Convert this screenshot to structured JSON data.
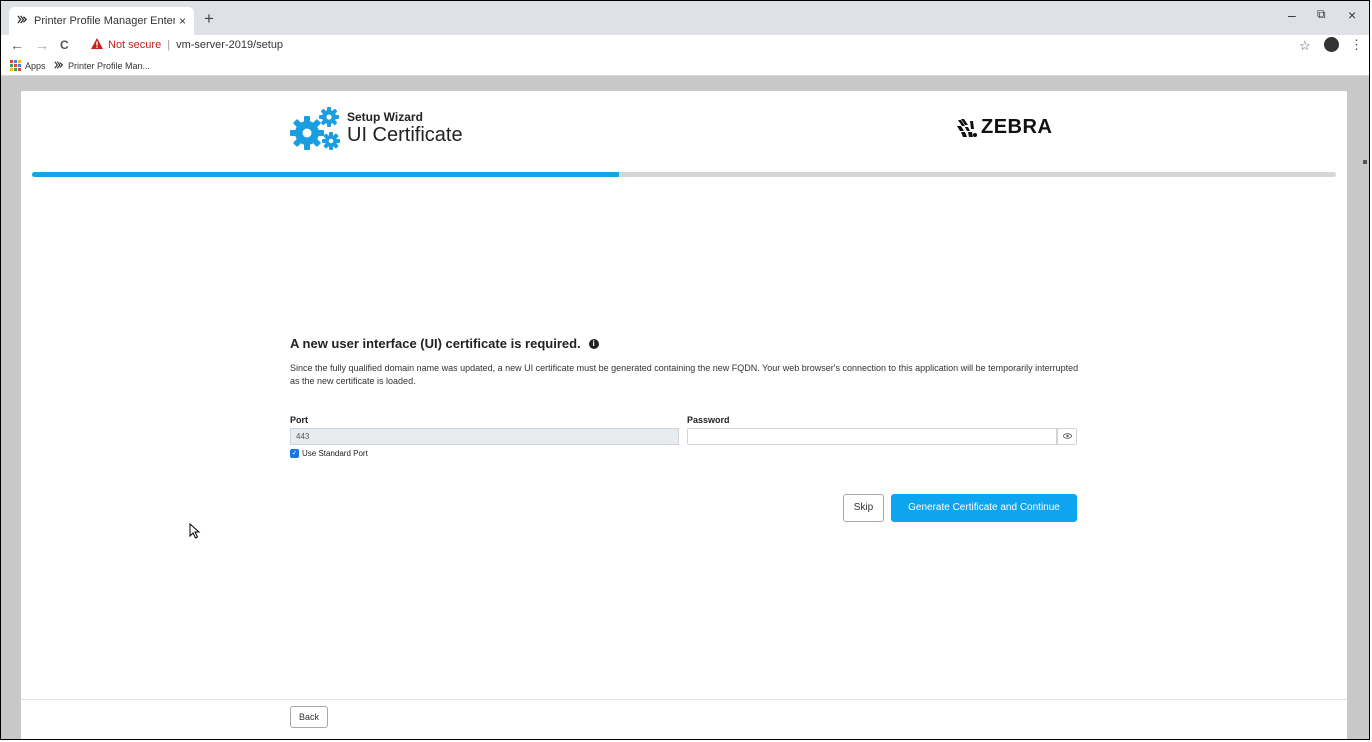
{
  "browser": {
    "tab_title": "Printer Profile Manager Enterpris",
    "tab_close": "×",
    "new_tab": "+",
    "nav": {
      "back": "←",
      "forward": "→",
      "reload": "C"
    },
    "security_label": "Not secure",
    "url_separator": "|",
    "url": "vm-server-2019/setup",
    "window_controls": {
      "minimize": "–",
      "restore": "⧉",
      "close": "×"
    },
    "bookmarks": [
      {
        "label": "Apps"
      },
      {
        "label": "Printer Profile Man..."
      }
    ]
  },
  "wizard": {
    "label": "Setup Wizard",
    "title": "UI Certificate",
    "brand": "ZEBRA",
    "progress_fraction": 0.45
  },
  "content": {
    "heading": "A new user interface (UI) certificate is required.",
    "info_glyph": "i",
    "description": "Since the fully qualified domain name was updated, a new UI certificate must be generated containing the new FQDN. Your web browser's connection to this application will be temporarily interrupted as the new certificate is loaded.",
    "port_label": "Port",
    "port_value": "443",
    "password_label": "Password",
    "password_value": "",
    "checkbox_label": "Use Standard Port",
    "checkbox_checked": true
  },
  "actions": {
    "skip": "Skip",
    "generate": "Generate Certificate and Continue",
    "back": "Back"
  },
  "colors": {
    "accent": "#18a3e8",
    "primary_button": "#0ea5f0",
    "warning": "#c5221f"
  }
}
